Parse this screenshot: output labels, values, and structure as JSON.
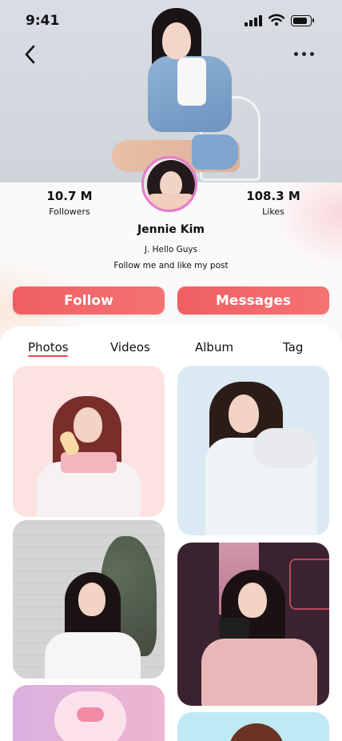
{
  "status_bar": {
    "time": "9:41"
  },
  "nav": {
    "back_icon": "chevron-left-icon",
    "more_icon": "more-horizontal-icon"
  },
  "profile": {
    "name": "Jennie Kim",
    "bio_line1": "J. Hello Guys",
    "bio_line2": "Follow me and like my post",
    "avatar_ring_color": "#e67acb",
    "followers": {
      "value": "10.7 M",
      "label": "Followers"
    },
    "likes": {
      "value": "108.3 M",
      "label": "Likes"
    }
  },
  "actions": {
    "follow_label": "Follow",
    "messages_label": "Messages",
    "accent": "#f06567"
  },
  "tabs": {
    "items": [
      {
        "label": "Photos",
        "active": true
      },
      {
        "label": "Videos",
        "active": false
      },
      {
        "label": "Album",
        "active": false
      },
      {
        "label": "Tag",
        "active": false
      }
    ],
    "active_color": "#e8474c"
  },
  "gallery": {
    "photos": [
      {
        "id": "photo-1",
        "background": "#fde2e2"
      },
      {
        "id": "photo-2",
        "background": "#dbe9f2"
      },
      {
        "id": "photo-3",
        "background": "#d8d8d8"
      },
      {
        "id": "photo-4",
        "background": "#3a2230"
      },
      {
        "id": "photo-5",
        "background": "#e9c7ea"
      },
      {
        "id": "photo-6",
        "background": "#bfe9f4"
      }
    ]
  }
}
